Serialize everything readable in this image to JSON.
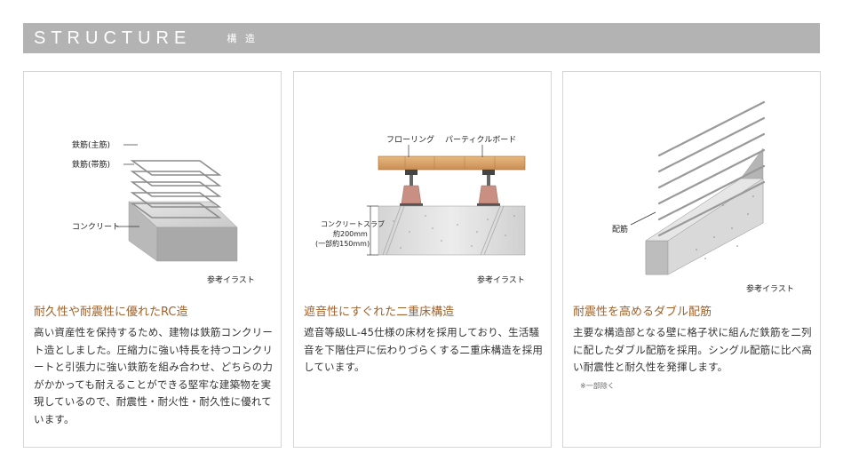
{
  "header": {
    "title": "STRUCTURE",
    "subtitle": "構 造"
  },
  "cards": [
    {
      "title": "耐久性や耐震性に優れたRC造",
      "body": "高い資産性を保持するため、建物は鉄筋コンクリート造としました。圧縮力に強い特長を持つコンクリートと引張力に強い鉄筋を組み合わせ、どちらの力がかかっても耐えることができる堅牢な建築物を実現しているので、耐震性・耐火性・耐久性に優れています。",
      "caption": "参考イラスト",
      "labels": {
        "main_rebar": "鉄筋(主筋)",
        "hoop_rebar": "鉄筋(帯筋)",
        "concrete": "コンクリート"
      }
    },
    {
      "title": "遮音性にすぐれた二重床構造",
      "body": "遮音等級LL-45仕様の床材を採用しており、生活騒音を下階住戸に伝わりづらくする二重床構造を採用しています。",
      "caption": "参考イラスト",
      "labels": {
        "flooring": "フローリング",
        "particle_board": "パーティクルボード",
        "slab_1": "コンクリートスラブ",
        "slab_2": "約200mm",
        "slab_3": "(一部約150mm)"
      }
    },
    {
      "title": "耐震性を高めるダブル配筋",
      "body": "主要な構造部となる壁に格子状に組んだ鉄筋を二列に配したダブル配筋を採用。シングル配筋に比べ高い耐震性と耐久性を発揮します。",
      "note": "※一部除く",
      "caption": "参考イラスト",
      "labels": {
        "rebar": "配筋"
      }
    }
  ]
}
